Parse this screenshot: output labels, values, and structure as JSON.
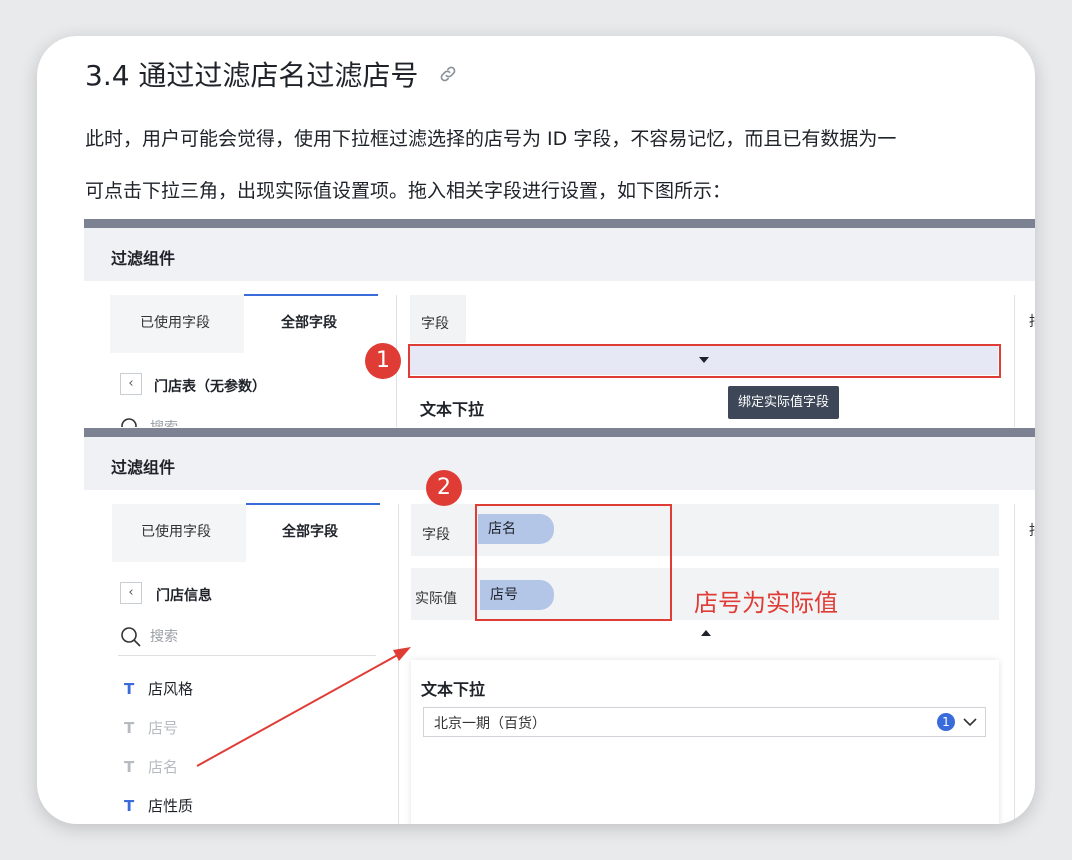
{
  "article": {
    "heading": "3.4 通过过滤店名过滤店号",
    "paragraph1": "此时，用户可能会觉得，使用下拉框过滤选择的店号为 ID 字段，不容易记忆，而且已有数据为一",
    "paragraph2": "可点击下拉三角，出现实际值设置项。拖入相关字段进行设置，如下图所示："
  },
  "shot1": {
    "header_title": "过滤组件",
    "tabs": [
      "已使用字段",
      "全部字段"
    ],
    "table_name": "门店表（无参数）",
    "search_placeholder": "搜索",
    "field_label": "字段",
    "step_number": "1",
    "section_title": "文本下拉",
    "tooltip": "绑定实际值字段",
    "edge_char": "拍"
  },
  "shot2": {
    "header_title": "过滤组件",
    "tabs": [
      "已使用字段",
      "全部字段"
    ],
    "table_name": "门店信息",
    "search_placeholder": "搜索",
    "step_number": "2",
    "field_label": "字段",
    "field_value": "店名",
    "actual_label": "实际值",
    "actual_value": "店号",
    "annotation": "店号为实际值",
    "field_list": [
      {
        "label": "店风格",
        "dim": false
      },
      {
        "label": "店号",
        "dim": true
      },
      {
        "label": "店名",
        "dim": true
      },
      {
        "label": "店性质",
        "dim": false
      }
    ],
    "section_title": "文本下拉",
    "select_value": "北京一期（百货）",
    "select_count": "1",
    "edge_char": "拍"
  },
  "icons": {
    "link": "link-icon",
    "search": "search-icon",
    "back": "chevron-left-icon",
    "text_field": "text-type-icon",
    "chevron_down": "chevron-down-icon"
  },
  "colors": {
    "accent": "#3a6bdb",
    "annotation_red": "#e03c36",
    "pill": "#b4c6e8"
  }
}
